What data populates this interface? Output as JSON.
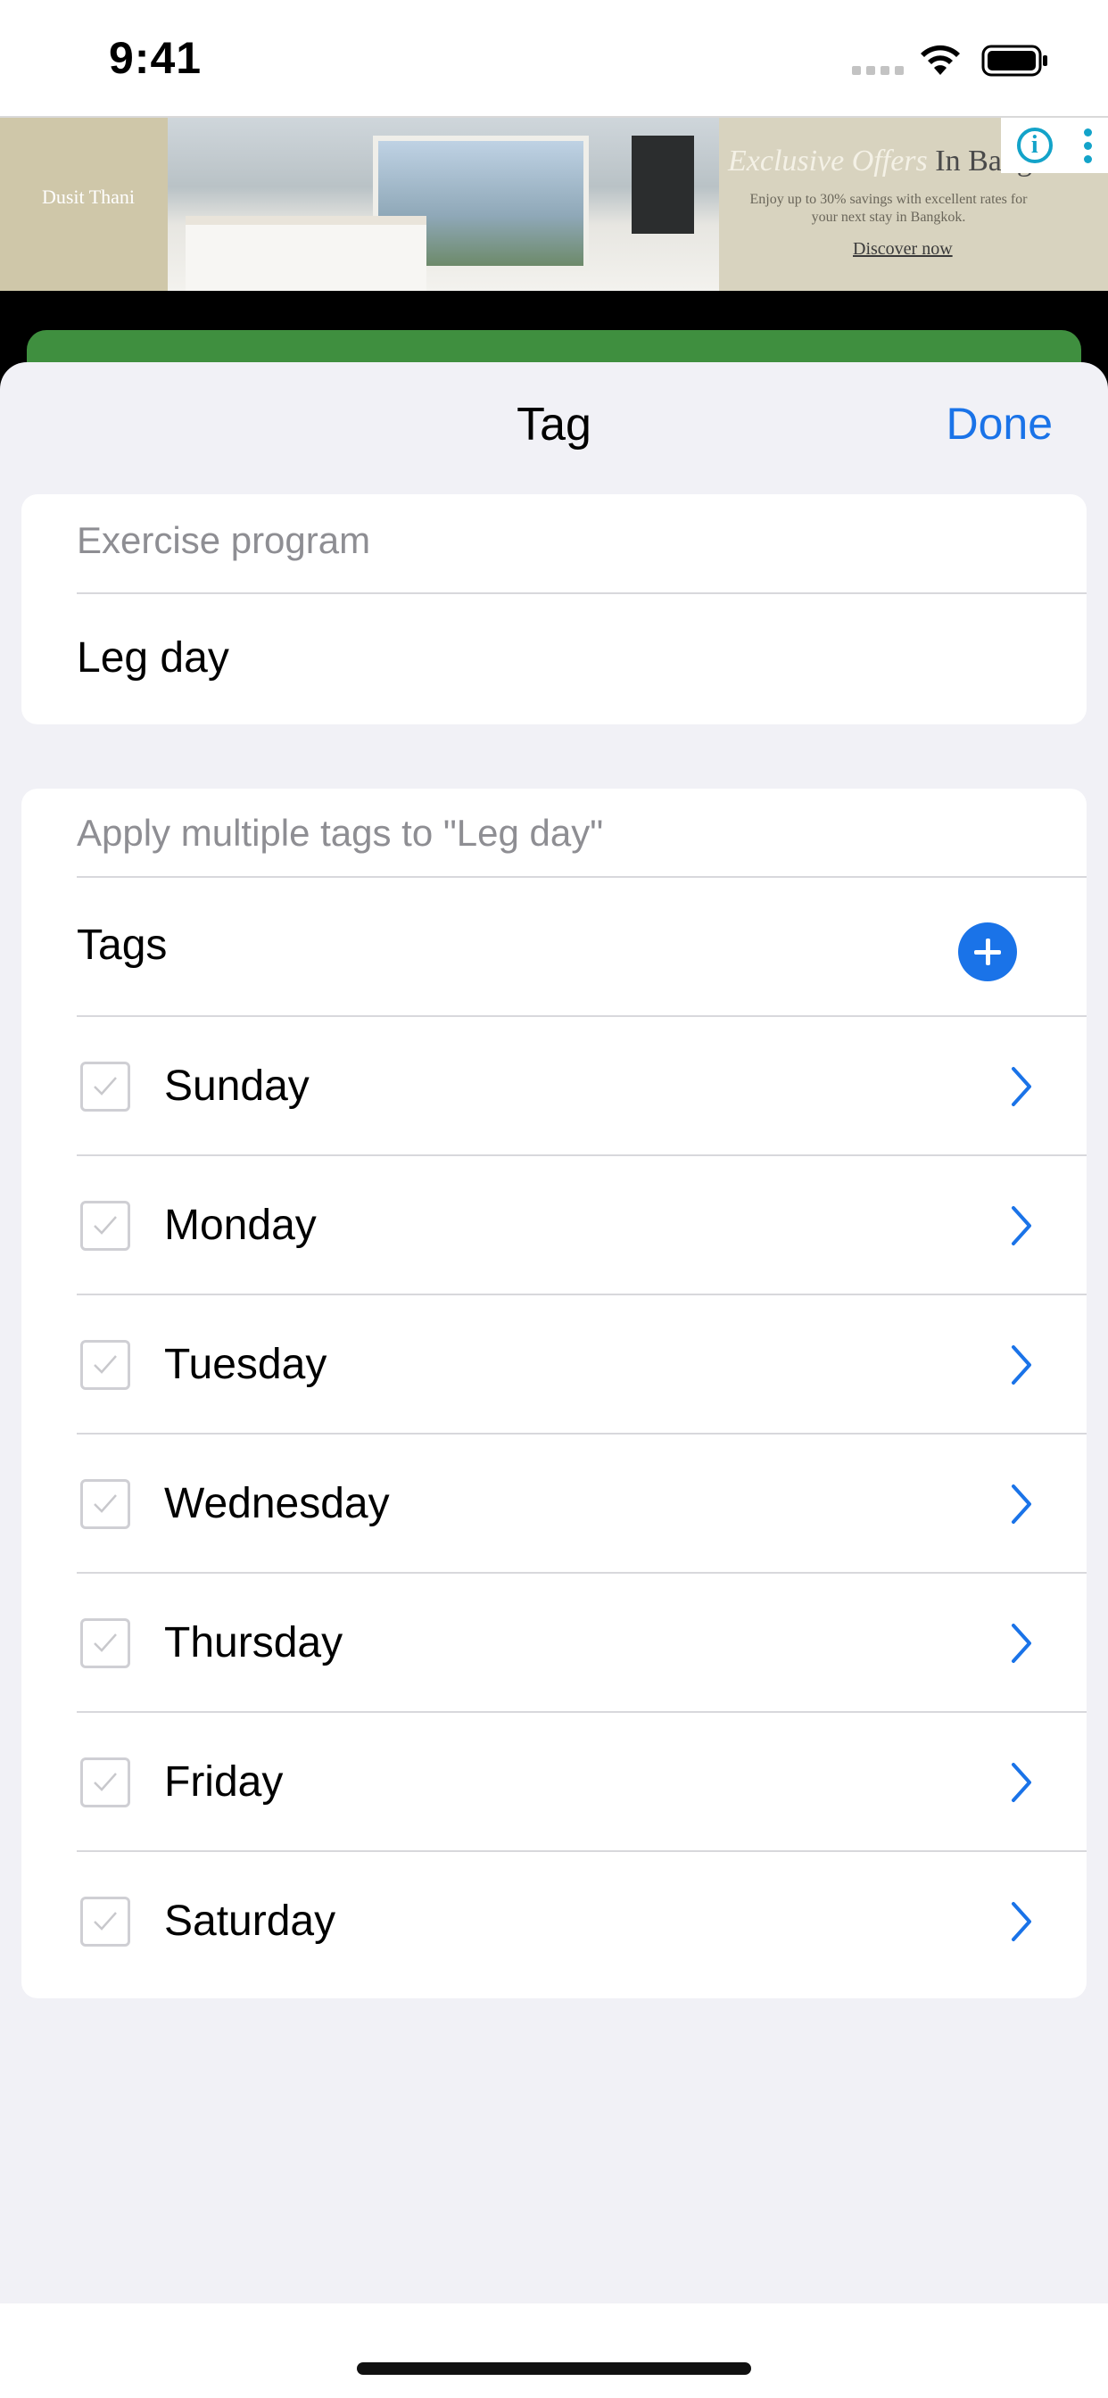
{
  "status_bar": {
    "time": "9:41"
  },
  "ad": {
    "brand": "Dusit Thani",
    "headline": "Exclusive Offers",
    "headline_tail": "In Bangkok",
    "copy": "Enjoy up to 30% savings with excellent rates for your next stay in Bangkok.",
    "cta": "Discover now",
    "info_glyph": "i"
  },
  "sheet": {
    "title": "Tag",
    "done_label": "Done"
  },
  "program_section": {
    "header": "Exercise program",
    "value": "Leg day"
  },
  "tags_section": {
    "header": "Apply multiple tags to \"Leg day\"",
    "tags_label": "Tags",
    "items": [
      {
        "label": "Sunday"
      },
      {
        "label": "Monday"
      },
      {
        "label": "Tuesday"
      },
      {
        "label": "Wednesday"
      },
      {
        "label": "Thursday"
      },
      {
        "label": "Friday"
      },
      {
        "label": "Saturday"
      }
    ]
  },
  "colors": {
    "accent": "#1a73e8",
    "sheet_background": "#f1f1f6",
    "ad_green": "#3f8f3f"
  }
}
